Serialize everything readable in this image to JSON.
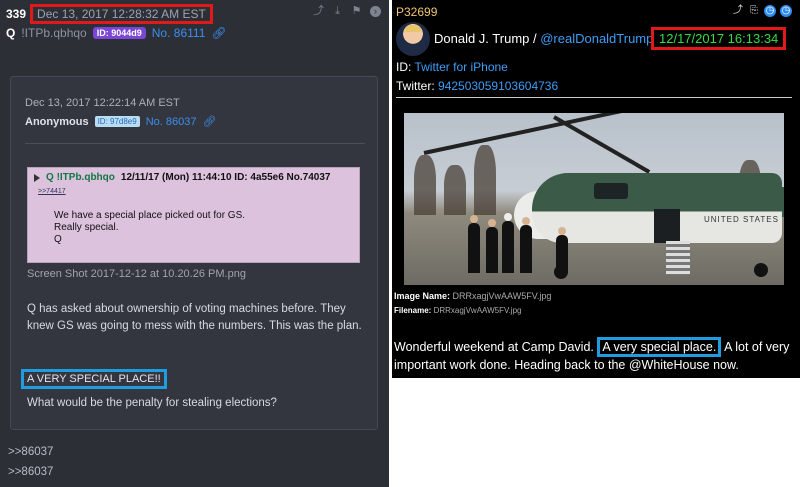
{
  "left": {
    "post_number": "339",
    "timestamp": "Dec 13, 2017 12:28:32 AM EST",
    "poster_name": "Q",
    "tripcode": "!ITPb.qbhqo",
    "id_badge": "ID: 9044d9",
    "post_link": "No. 86111",
    "quoted": {
      "timestamp": "Dec 13, 2017 12:22:14 AM EST",
      "poster_name": "Anonymous",
      "id_badge": "ID: 97d8e9",
      "post_link": "No. 86037",
      "screenshot": {
        "header_name": "Q",
        "header_trip": "!ITPb.qbhqo",
        "header_meta": "12/11/17 (Mon) 11:44:10 ID: 4a55e6 No.74037",
        "reference": ">>74417",
        "line1": "We have a special place picked out for GS.",
        "line2": "Really special.",
        "line3": "Q"
      },
      "filename": "Screen Shot 2017-12-12 at 10.20.26 PM.png",
      "body": "Q has asked about ownership of voting machines before. They knew GS was going to mess with the numbers. This was the plan.",
      "highlight": "A VERY SPECIAL PLACE!!",
      "question": "What would be the penalty for stealing elections?"
    },
    "replies": [
      ">>86037",
      ">>86037"
    ]
  },
  "right": {
    "post_id": "P32699",
    "display_name": "Donald J. Trump",
    "separator": " / ",
    "handle": "@realDonaldTrump",
    "timestamp": "12/17/2017 16:13:34",
    "id_label": "ID:",
    "id_value": "Twitter for iPhone",
    "twitter_label": "Twitter:",
    "twitter_value": "942503059103604736",
    "image_name_label": "Image Name:",
    "image_name_value": "DRRxagjVwAAW5FV.jpg",
    "filename_label": "Filename:",
    "filename_value": "DRRxagjVwAAW5FV.jpg",
    "photo_text": "UNITED STATES",
    "text_before": "Wonderful weekend at Camp David.",
    "text_highlight": "A very special place.",
    "text_after": " A lot of very important work done. Heading back to the @WhiteHouse now."
  },
  "colors": {
    "highlight_red": "#e11919",
    "highlight_blue": "#1f9de0",
    "timestamp_green": "#33dd44",
    "link_blue": "#3c8ff0"
  }
}
